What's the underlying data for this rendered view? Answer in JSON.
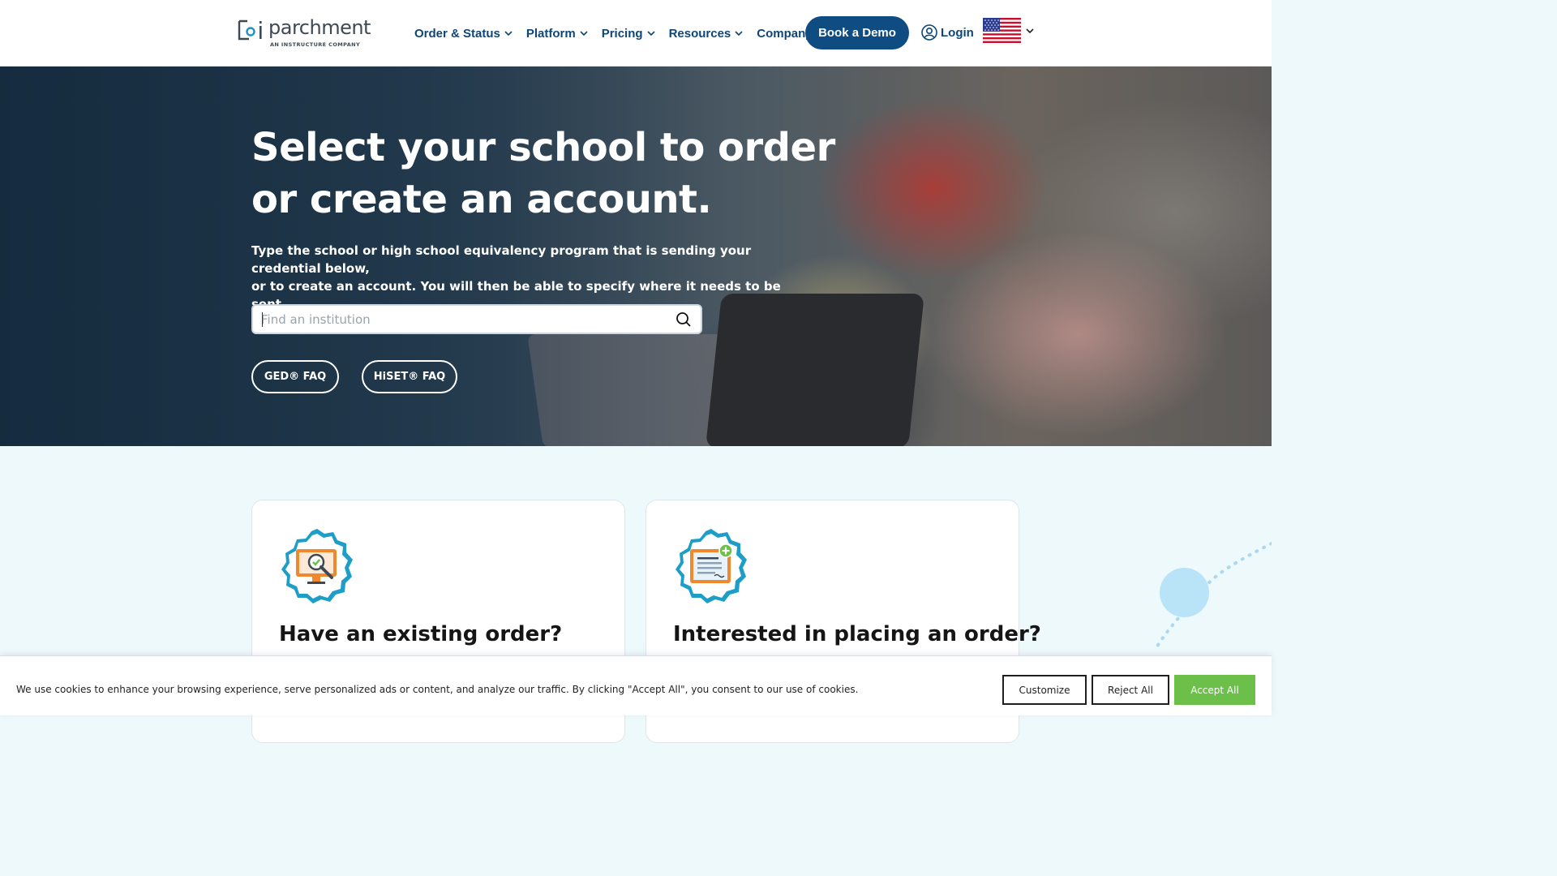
{
  "header": {
    "logo": {
      "name": "parchment",
      "tagline": "AN INSTRUCTURE COMPANY"
    },
    "nav": [
      {
        "label": "Order & Status"
      },
      {
        "label": "Platform"
      },
      {
        "label": "Pricing"
      },
      {
        "label": "Resources"
      },
      {
        "label": "Company"
      }
    ],
    "demo_button": "Book a Demo",
    "login": "Login",
    "locale_icon": "us-flag-icon"
  },
  "hero": {
    "title_line1": "Select your school to order",
    "title_line2": "or create an account.",
    "subtitle_line1": "Type the school or high school equivalency program that is sending your credential below,",
    "subtitle_line2": "or to create an account. You will then be able to specify where it needs to be sent.",
    "search": {
      "placeholder": "Find an institution",
      "value": ""
    },
    "faq_buttons": [
      "GED® FAQ",
      "HiSET® FAQ"
    ]
  },
  "cards": [
    {
      "title": "Have an existing order?",
      "icon": "monitor-search-check-icon"
    },
    {
      "title": "Interested in placing an order?",
      "icon": "document-add-icon"
    }
  ],
  "cookie_banner": {
    "text": "We use cookies to enhance your browsing experience, serve personalized ads or content, and analyze our traffic. By clicking \"Accept All\", you consent to our use of cookies.",
    "customize": "Customize",
    "reject": "Reject All",
    "accept": "Accept All"
  },
  "colors": {
    "brand_navy": "#0f4c81",
    "nav_text": "#0d4677",
    "accept_green": "#6cc04a",
    "page_bg": "#eef9fc"
  }
}
